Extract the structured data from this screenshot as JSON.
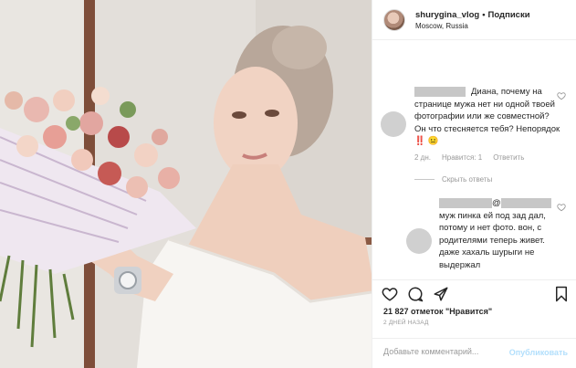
{
  "post": {
    "username": "shurygina_vlog",
    "separator": "•",
    "follow_label": "Подписки",
    "location": "Moscow, Russia"
  },
  "comments": [
    {
      "text": "Диана, почему на странице мужа нет ни одной твоей фотографии или же совместной? Он что стесняется тебя? Непорядок ‼️ 😐",
      "time": "2 дн.",
      "likes": "Нравится: 1",
      "reply_label": "Ответить",
      "view_replies": "Скрыть ответы"
    },
    {
      "mention": "@",
      "text": "муж пинка ей под зад дал, потому и нет фото. вон, с родителями теперь живет. даже хахаль шурыги не выдержал"
    }
  ],
  "actions": {
    "icons": [
      "heart-icon",
      "comment-icon",
      "share-icon",
      "bookmark-icon"
    ]
  },
  "likes_text": "21 827 отметок \"Нравится\"",
  "date_text": "2 ДНЕЙ НАЗАД",
  "comment_box": {
    "placeholder": "Добавьте комментарий...",
    "publish_label": "Опубликовать"
  },
  "colors": {
    "link_blue_disabled": "#b2dffc",
    "text": "#262626",
    "muted": "#999999",
    "redaction": "#c7c7c7"
  }
}
